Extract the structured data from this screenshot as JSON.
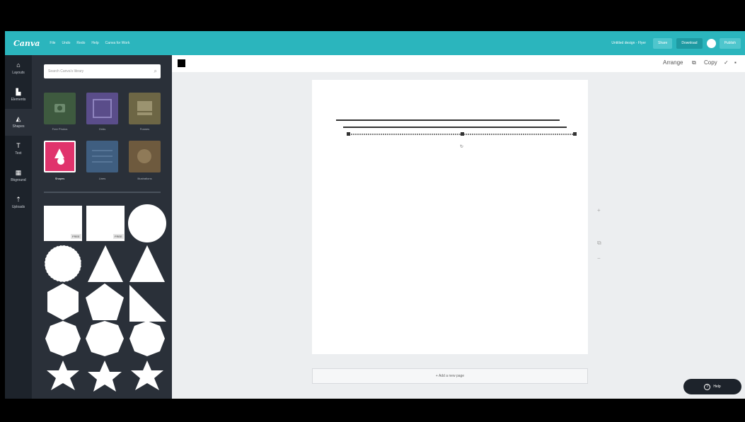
{
  "header": {
    "logo": "Canva",
    "menu": [
      "File",
      "Undo",
      "Redo",
      "Help",
      "Canva for Work"
    ],
    "doc_title": "Untitled design - Flyer",
    "share_label": "Share",
    "download_label": "Download",
    "publish_label": "Publish"
  },
  "rail": [
    {
      "icon": "layout-icon",
      "glyph": "⌂",
      "label": "Layouts"
    },
    {
      "icon": "layers-icon",
      "glyph": "▙",
      "label": "Elements"
    },
    {
      "icon": "shapes-icon",
      "glyph": "◭",
      "label": "Shapes"
    },
    {
      "icon": "text-icon",
      "glyph": "T",
      "label": "Text"
    },
    {
      "icon": "background-icon",
      "glyph": "▦",
      "label": "Bkground"
    },
    {
      "icon": "upload-icon",
      "glyph": "⇡",
      "label": "Uploads"
    }
  ],
  "panel": {
    "search_placeholder": "Search Canva's library",
    "categories": [
      {
        "label": "Free Photos",
        "color": "#3e5a3f"
      },
      {
        "label": "Grids",
        "color": "#5a4d8a"
      },
      {
        "label": "Frames",
        "color": "#6d6645"
      },
      {
        "label": "Shapes",
        "color": "#e0336c"
      },
      {
        "label": "Lines",
        "color": "#3f5e80"
      },
      {
        "label": "Illustrations",
        "color": "#6e5a3e"
      }
    ],
    "free_badge": "FREE"
  },
  "toolbar": {
    "color": "#000000",
    "arrange_label": "Arrange",
    "copy_label": "Copy"
  },
  "canvas": {
    "add_page_label": "+ Add a new page",
    "side_controls": [
      "+",
      "⧉",
      "−"
    ]
  },
  "help": {
    "label": "Help"
  }
}
